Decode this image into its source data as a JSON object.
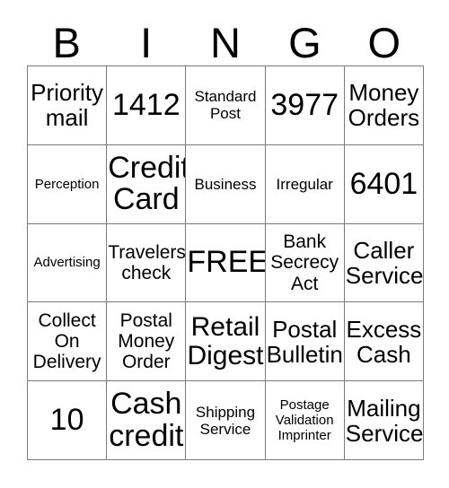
{
  "card": {
    "title": "BINGO",
    "headers": [
      "B",
      "I",
      "N",
      "G",
      "O"
    ],
    "border_color": "#7a7a7a",
    "text_color": "#000000",
    "background_color": "#ffffff",
    "columns": 5,
    "rows": 5,
    "cells": [
      {
        "text": "Priority\nmail",
        "size": "l"
      },
      {
        "text": "1412",
        "size": "xxl"
      },
      {
        "text": "Standard\nPost",
        "size": "s"
      },
      {
        "text": "3977",
        "size": "xxl"
      },
      {
        "text": "Money\nOrders",
        "size": "l"
      },
      {
        "text": "Perception",
        "size": "xs"
      },
      {
        "text": "Credit\nCard",
        "size": "xxl"
      },
      {
        "text": "Business",
        "size": "s"
      },
      {
        "text": "Irregular",
        "size": "s"
      },
      {
        "text": "6401",
        "size": "xxl"
      },
      {
        "text": "Advertising",
        "size": "xs"
      },
      {
        "text": "Travelers\ncheck",
        "size": "m"
      },
      {
        "text": "FREE",
        "size": "xxl"
      },
      {
        "text": "Bank\nSecrecy\nAct",
        "size": "m"
      },
      {
        "text": "Caller\nService",
        "size": "l"
      },
      {
        "text": "Collect\nOn\nDelivery",
        "size": "m"
      },
      {
        "text": "Postal\nMoney\nOrder",
        "size": "m"
      },
      {
        "text": "Retail\nDigest",
        "size": "xl"
      },
      {
        "text": "Postal\nBulletin",
        "size": "l"
      },
      {
        "text": "Excess\nCash",
        "size": "l"
      },
      {
        "text": "10",
        "size": "xxl"
      },
      {
        "text": "Cash\ncredit",
        "size": "xxl"
      },
      {
        "text": "Shipping\nService",
        "size": "s"
      },
      {
        "text": "Postage\nValidation\nImprinter",
        "size": "xs"
      },
      {
        "text": "Mailing\nService",
        "size": "l"
      }
    ]
  }
}
